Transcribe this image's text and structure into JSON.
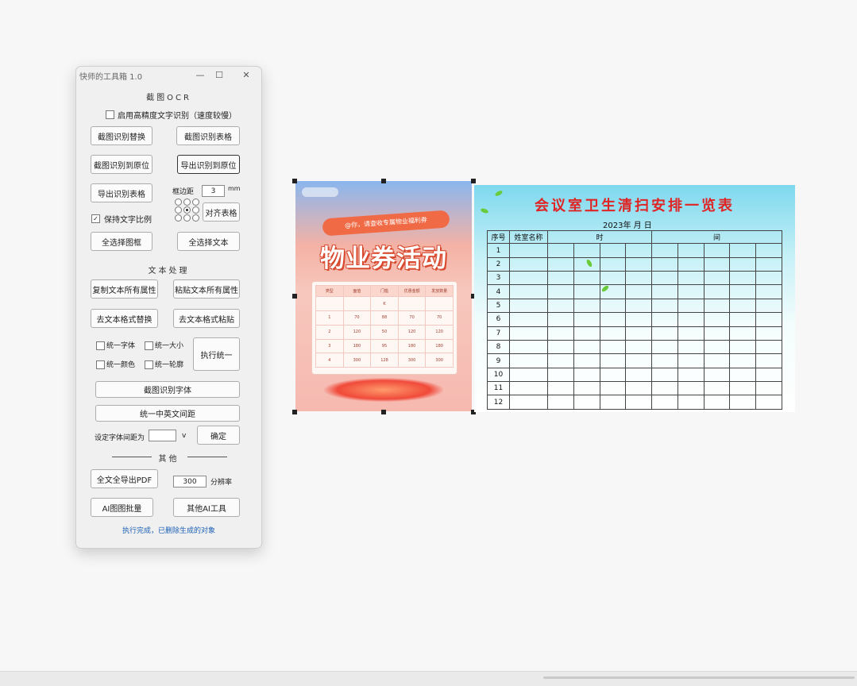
{
  "window": {
    "title": "快师的工具箱 1.0",
    "controls": {
      "minimize": "—",
      "maximize": "☐",
      "close": "✕"
    }
  },
  "ocr": {
    "heading": "截图OCR",
    "hq_checkbox_label": "启用高精度文字识别（速度较慢）",
    "hq_checked": false,
    "btn_replace": "截图识别替换",
    "btn_table": "截图识别表格",
    "btn_restore": "截图识别到原位",
    "btn_export_restore": "导出识别到原位",
    "btn_export_table": "导出识别表格",
    "margin_label": "框边距",
    "margin_value": "3",
    "margin_unit": "mm",
    "align_button": "对齐表格",
    "keep_ratio_label": "保持文字比例",
    "keep_ratio_checked": true,
    "btn_select_frame": "全选择图框",
    "btn_select_text": "全选择文本"
  },
  "text": {
    "heading": "文本处理",
    "btn_copy_attrs": "复制文本所有属性",
    "btn_paste_attrs": "粘贴文本所有属性",
    "btn_format_replace": "去文本格式替换",
    "btn_format_paste": "去文本格式粘贴",
    "cb_font": "统一字体",
    "cb_size": "统一大小",
    "cb_color": "统一颜色",
    "cb_outline": "统一轮廓",
    "btn_apply_unify": "执行统一",
    "btn_screenshot_font": "截图识别字体",
    "btn_unify_spacing": "统一中英文间距",
    "spacing_label": "设定字体间距为",
    "spacing_value": "",
    "spacing_unit": "v",
    "btn_confirm": "确定"
  },
  "other": {
    "heading": "其他",
    "btn_export_pdf": "全文全导出PDF",
    "dpi_value": "300",
    "dpi_label": "分辨率",
    "btn_import_images": "AI图图批量",
    "btn_more_tools": "其他AI工具"
  },
  "status": "执行完成，已删除生成的对象",
  "poster": {
    "banner": "@你，请查收专属物业福利券",
    "title": "物业券活动",
    "table_header": [
      "类型",
      "面值",
      "门槛",
      "优惠金额",
      "发放数量"
    ],
    "table_header_sub": "K",
    "table_rows": [
      [
        "1",
        "70",
        "88",
        "70",
        "70"
      ],
      [
        "2",
        "120",
        "50",
        "120",
        "120"
      ],
      [
        "3",
        "180",
        "95",
        "180",
        "180"
      ],
      [
        "4",
        "300",
        "128",
        "300",
        "300"
      ]
    ]
  },
  "schedule": {
    "title": "会议室卫生清扫安排一览表",
    "date_line": "2023年   月   日",
    "col_no": "序号",
    "col_name": "姓室名称",
    "col_time_a": "时",
    "col_time_b": "间",
    "rows": [
      "1",
      "2",
      "3",
      "4",
      "5",
      "6",
      "7",
      "8",
      "9",
      "10",
      "11",
      "12"
    ]
  }
}
